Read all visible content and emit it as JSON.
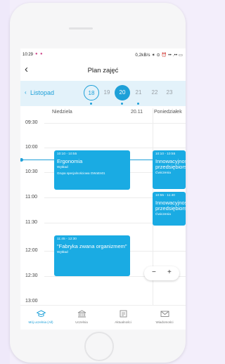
{
  "status": {
    "time": "10:29",
    "right": "0,2kB/s ✶ ⊙ ⏰ •• .•• ▭"
  },
  "header": {
    "title": "Plan zajęć"
  },
  "datebar": {
    "month": "Listopad",
    "days": [
      "18",
      "19",
      "20",
      "21",
      "22",
      "23"
    ],
    "active_day": "20",
    "accent": "#1ea0d8"
  },
  "columns": {
    "day1": "Niedziela",
    "day1_date": "20.11",
    "day2": "Poniedziałek"
  },
  "times": [
    "09:30",
    "10:00",
    "10:30",
    "11:00",
    "11:30",
    "12:00",
    "12:30",
    "13:00"
  ],
  "events": [
    {
      "time": "10:10 - 10:55",
      "name": "Ergonomia",
      "type": "Wykład",
      "group": "Grupa specjalnościowa GWoEn01"
    },
    {
      "time": "11:45 - 12:30",
      "name": "\"Fabryka zwana organizmem\"",
      "type": "Wykład"
    },
    {
      "time": "10:10 - 10:55",
      "name": "Innowacyjność przedsiębiorstw",
      "type": "Ćwiczenia"
    },
    {
      "time": "10:55 - 11:40",
      "name": "Innowacyjność przedsiębiorstw",
      "type": "Ćwiczenia"
    }
  ],
  "zoom": {
    "minus": "−",
    "plus": "+"
  },
  "nav": [
    "Mój uczelnia (All)",
    "Uczelnia",
    "Aktualności",
    "Wiadomości"
  ]
}
